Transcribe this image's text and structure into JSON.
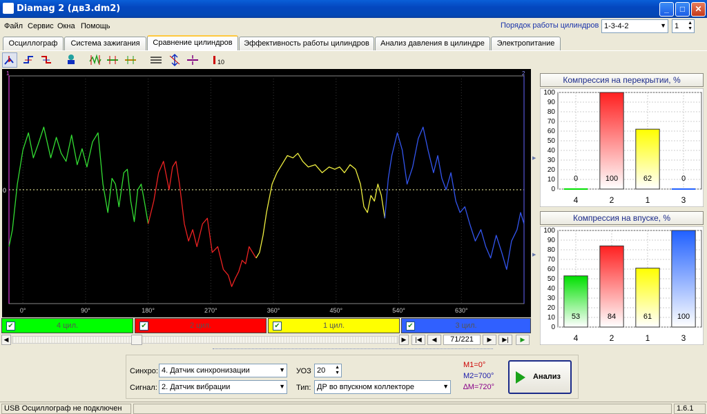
{
  "window": {
    "title": "Diamag 2 (дв3.dm2)",
    "min": "_",
    "max": "□",
    "close": "✕"
  },
  "menu": [
    "Файл",
    "Сервис",
    "Окна",
    "Помощь"
  ],
  "order": {
    "label": "Порядок работы цилиндров",
    "value": "1-3-4-2",
    "num": "1"
  },
  "tabs": [
    "Осциллограф",
    "Система зажигания",
    "Сравнение цилиндров",
    "Эффективность работы цилиндров",
    "Анализ давления в цилиндре",
    "Электропитание"
  ],
  "active_tab": 2,
  "toolbar_icons": [
    "cursor-tool-icon",
    "rise-edge-icon",
    "fall-edge-icon",
    "probe-icon",
    "cyl-split-icon",
    "cyl-shift-icon",
    "cyl-merge-icon",
    "hlines-icon",
    "vscale-icon",
    "zero-line-icon",
    "bar-chart-icon"
  ],
  "scope": {
    "zero_label": "0",
    "marker1": "1",
    "marker2": "2",
    "x_ticks": [
      "0°",
      "90°",
      "180°",
      "270°",
      "360°",
      "450°",
      "540°",
      "630°"
    ]
  },
  "channels": [
    {
      "label": "4 цил.",
      "color": "#00ff00",
      "checked": true
    },
    {
      "label": "2 цил.",
      "color": "#ff0000",
      "checked": true
    },
    {
      "label": "1 цил.",
      "color": "#ffff00",
      "checked": true
    },
    {
      "label": "3 цил.",
      "color": "#3060ff",
      "checked": true
    }
  ],
  "nav": {
    "page": "71/221"
  },
  "controls": {
    "sync_label": "Синхро:",
    "sync_value": "4.  Датчик синхронизации",
    "signal_label": "Сигнал:",
    "signal_value": "2.  Датчик вибрации",
    "uoz_label": "УОЗ",
    "uoz_value": "20",
    "type_label": "Тип:",
    "type_value": "ДР во впускном коллекторе",
    "m1": "M1=0°",
    "m2": "M2=700°",
    "dm": "∆M=720°",
    "analyze": "Анализ"
  },
  "chart_data": [
    {
      "type": "bar",
      "title": "Компрессия на перекрытии, %",
      "categories": [
        "4",
        "2",
        "1",
        "3"
      ],
      "values": [
        0,
        100,
        62,
        0
      ],
      "colors": [
        "#00e000",
        "#ff2020",
        "#ffff00",
        "#2060ff"
      ],
      "ylim": [
        0,
        100
      ],
      "yticks": [
        "100",
        "90",
        "80",
        "70",
        "60",
        "50",
        "40",
        "30",
        "20",
        "10",
        "0"
      ],
      "grid": true
    },
    {
      "type": "bar",
      "title": "Компрессия на впуске, %",
      "categories": [
        "4",
        "2",
        "1",
        "3"
      ],
      "values": [
        53,
        84,
        61,
        100
      ],
      "colors": [
        "#00e000",
        "#ff2020",
        "#ffff00",
        "#2060ff"
      ],
      "ylim": [
        0,
        100
      ],
      "yticks": [
        "100",
        "90",
        "80",
        "70",
        "60",
        "50",
        "40",
        "30",
        "20",
        "10",
        "0"
      ],
      "grid": true
    },
    {
      "type": "line",
      "title": "",
      "xlabel": "",
      "ylabel": "",
      "x_ticks": [
        "0°",
        "90°",
        "180°",
        "270°",
        "360°",
        "450°",
        "540°",
        "630°"
      ],
      "xlim": [
        -20,
        720
      ],
      "ylim": [
        -1,
        1
      ],
      "grid": true,
      "series": [
        {
          "name": "4 цил.",
          "color": "#33dd33",
          "x": [
            -20,
            -15,
            -8,
            0,
            8,
            15,
            22,
            30,
            40,
            48,
            55,
            62,
            70,
            78,
            85,
            92,
            100,
            108,
            115,
            122,
            128,
            133,
            138,
            145,
            150,
            155,
            160,
            165,
            170,
            175,
            180
          ],
          "y": [
            -0.5,
            -0.35,
            0.05,
            0.35,
            0.5,
            0.28,
            0.4,
            0.55,
            0.28,
            0.46,
            0.32,
            0.25,
            0.48,
            0.22,
            0.36,
            0.2,
            0.42,
            0.5,
            0.05,
            -0.2,
            0.1,
            0.05,
            -0.15,
            0.15,
            0.18,
            -0.1,
            -0.28,
            0.0,
            0.05,
            -0.12,
            -0.3
          ]
        },
        {
          "name": "2 цил.",
          "color": "#ee2222",
          "x": [
            180,
            188,
            195,
            202,
            210,
            215,
            220,
            225,
            232,
            238,
            244,
            250,
            258,
            265,
            272,
            280,
            288,
            295,
            300,
            305,
            310,
            315,
            320,
            325,
            330,
            335
          ],
          "y": [
            -0.3,
            -0.1,
            0.15,
            0.25,
            0.0,
            0.2,
            0.25,
            0.05,
            -0.3,
            -0.45,
            -0.35,
            -0.5,
            -0.3,
            -0.25,
            -0.55,
            -0.5,
            -0.7,
            -0.75,
            -0.85,
            -0.78,
            -0.72,
            -0.62,
            -0.65,
            -0.5,
            -0.55,
            -0.6
          ]
        },
        {
          "name": "1 цил.",
          "color": "#f0f040",
          "x": [
            335,
            340,
            345,
            350,
            358,
            365,
            372,
            380,
            388,
            395,
            402,
            410,
            420,
            430,
            440,
            448,
            455,
            462,
            470,
            478,
            485,
            490,
            495,
            500,
            505,
            510,
            515,
            520
          ],
          "y": [
            -0.6,
            -0.55,
            -0.4,
            -0.2,
            0.05,
            0.15,
            0.22,
            0.3,
            0.28,
            0.32,
            0.25,
            0.2,
            0.22,
            0.15,
            0.2,
            0.18,
            0.2,
            0.15,
            0.22,
            0.18,
            0.05,
            -0.15,
            -0.2,
            -0.05,
            -0.1,
            0.05,
            -0.05,
            -0.25
          ]
        },
        {
          "name": "3 цил.",
          "color": "#3355ee",
          "x": [
            520,
            525,
            530,
            538,
            545,
            552,
            560,
            568,
            575,
            582,
            590,
            596,
            602,
            608,
            615,
            622,
            628,
            635,
            642,
            650,
            658,
            665,
            672,
            680,
            688,
            695,
            702,
            710,
            715,
            720
          ],
          "y": [
            -0.25,
            0.1,
            0.3,
            0.5,
            0.35,
            0.05,
            0.2,
            0.45,
            0.55,
            0.35,
            0.15,
            0.3,
            0.1,
            0.0,
            0.15,
            -0.1,
            -0.2,
            -0.15,
            -0.3,
            -0.45,
            -0.35,
            -0.5,
            -0.6,
            -0.4,
            -0.55,
            -0.7,
            -0.45,
            -0.35,
            -0.2,
            -0.3
          ]
        }
      ]
    }
  ],
  "status": {
    "left": "USB Осциллограф не подключен",
    "middle": "",
    "version": "1.6.1"
  }
}
